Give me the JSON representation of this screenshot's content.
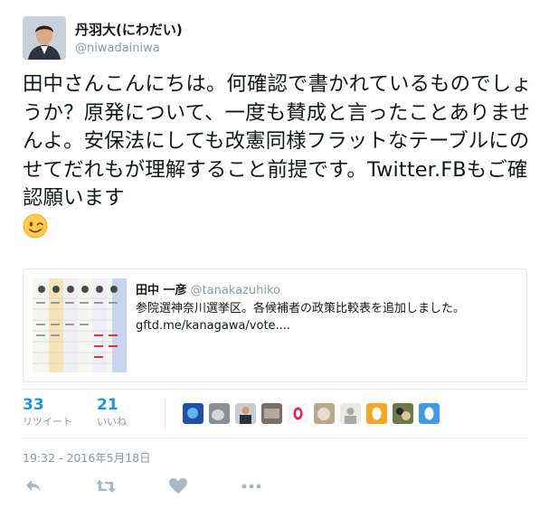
{
  "author": {
    "name": "丹羽大(にわだい)",
    "handle": "@niwadainiwa"
  },
  "tweet": {
    "text": "田中さんこんにちは。何確認で書かれているものでしょうか？原発について、一度も賛成と言ったことありませんよ。安保法にしても改憲同様フラットなテーブルにのせてだれもが理解すること前提です。Twitter.FBもご確認願います",
    "emoji": "winking-face"
  },
  "quoted": {
    "name": "田中 一彦",
    "handle": "@tanakazuhiko",
    "text_line1": "参院選神奈川選挙区。各候補者の政策比較表を追加しました。",
    "text_line2": "gftd.me/kanagawa/vote...."
  },
  "stats": {
    "retweets": "33",
    "retweets_label": "リツイート",
    "likes": "21",
    "likes_label": "いいね"
  },
  "likers": [
    {
      "name": "liker-1",
      "color": "#1f4fa8"
    },
    {
      "name": "liker-2",
      "color": "#8a8f96"
    },
    {
      "name": "liker-3",
      "color": "#3a3f46"
    },
    {
      "name": "liker-4",
      "color": "#7a6f66"
    },
    {
      "name": "liker-5",
      "color": "#f5f8fa"
    },
    {
      "name": "liker-6",
      "color": "#e0245e"
    },
    {
      "name": "liker-7",
      "color": "#b9a98a"
    },
    {
      "name": "liker-8",
      "color": "#a8a9a4"
    },
    {
      "name": "liker-9",
      "color": "#f5a623"
    },
    {
      "name": "liker-10",
      "color": "#6b7a4a"
    },
    {
      "name": "liker-11",
      "color": "#3d9be9"
    }
  ],
  "timestamp": "19:32 - 2016年5月18日",
  "colors": {
    "accent": "#1b95e0",
    "muted": "#8899a6",
    "text": "#14171a"
  }
}
